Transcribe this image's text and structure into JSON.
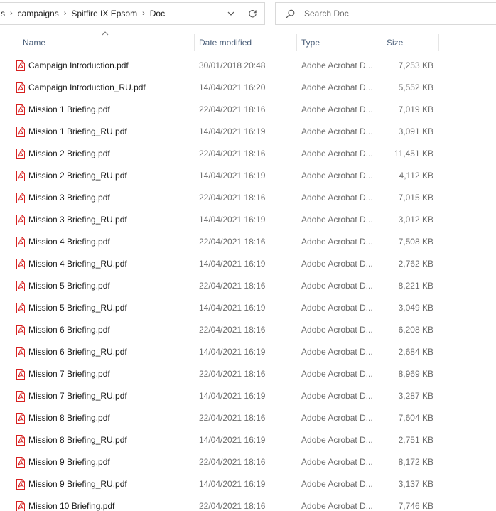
{
  "address_bar": {
    "crumbs": [
      "s",
      "campaigns",
      "Spitfire IX Epsom",
      "Doc"
    ]
  },
  "search": {
    "placeholder": "Search Doc"
  },
  "columns": {
    "name": "Name",
    "date": "Date modified",
    "type": "Type",
    "size": "Size"
  },
  "colors": {
    "pdf_icon": "#d6201f",
    "header_text": "#4c607a",
    "secondary_text": "#6d6d6d"
  },
  "files": [
    {
      "name": "Campaign Introduction.pdf",
      "date": "30/01/2018 20:48",
      "type": "Adobe Acrobat D...",
      "size": "7,253 KB"
    },
    {
      "name": "Campaign Introduction_RU.pdf",
      "date": "14/04/2021 16:20",
      "type": "Adobe Acrobat D...",
      "size": "5,552 KB"
    },
    {
      "name": "Mission 1 Briefing.pdf",
      "date": "22/04/2021 18:16",
      "type": "Adobe Acrobat D...",
      "size": "7,019 KB"
    },
    {
      "name": "Mission 1 Briefing_RU.pdf",
      "date": "14/04/2021 16:19",
      "type": "Adobe Acrobat D...",
      "size": "3,091 KB"
    },
    {
      "name": "Mission 2 Briefing.pdf",
      "date": "22/04/2021 18:16",
      "type": "Adobe Acrobat D...",
      "size": "11,451 KB"
    },
    {
      "name": "Mission 2 Briefing_RU.pdf",
      "date": "14/04/2021 16:19",
      "type": "Adobe Acrobat D...",
      "size": "4,112 KB"
    },
    {
      "name": "Mission 3 Briefing.pdf",
      "date": "22/04/2021 18:16",
      "type": "Adobe Acrobat D...",
      "size": "7,015 KB"
    },
    {
      "name": "Mission 3 Briefing_RU.pdf",
      "date": "14/04/2021 16:19",
      "type": "Adobe Acrobat D...",
      "size": "3,012 KB"
    },
    {
      "name": "Mission 4 Briefing.pdf",
      "date": "22/04/2021 18:16",
      "type": "Adobe Acrobat D...",
      "size": "7,508 KB"
    },
    {
      "name": "Mission 4 Briefing_RU.pdf",
      "date": "14/04/2021 16:19",
      "type": "Adobe Acrobat D...",
      "size": "2,762 KB"
    },
    {
      "name": "Mission 5 Briefing.pdf",
      "date": "22/04/2021 18:16",
      "type": "Adobe Acrobat D...",
      "size": "8,221 KB"
    },
    {
      "name": "Mission 5 Briefing_RU.pdf",
      "date": "14/04/2021 16:19",
      "type": "Adobe Acrobat D...",
      "size": "3,049 KB"
    },
    {
      "name": "Mission 6 Briefing.pdf",
      "date": "22/04/2021 18:16",
      "type": "Adobe Acrobat D...",
      "size": "6,208 KB"
    },
    {
      "name": "Mission 6 Briefing_RU.pdf",
      "date": "14/04/2021 16:19",
      "type": "Adobe Acrobat D...",
      "size": "2,684 KB"
    },
    {
      "name": "Mission 7 Briefing.pdf",
      "date": "22/04/2021 18:16",
      "type": "Adobe Acrobat D...",
      "size": "8,969 KB"
    },
    {
      "name": "Mission 7 Briefing_RU.pdf",
      "date": "14/04/2021 16:19",
      "type": "Adobe Acrobat D...",
      "size": "3,287 KB"
    },
    {
      "name": "Mission 8 Briefing.pdf",
      "date": "22/04/2021 18:16",
      "type": "Adobe Acrobat D...",
      "size": "7,604 KB"
    },
    {
      "name": "Mission 8 Briefing_RU.pdf",
      "date": "14/04/2021 16:19",
      "type": "Adobe Acrobat D...",
      "size": "2,751 KB"
    },
    {
      "name": "Mission 9 Briefing.pdf",
      "date": "22/04/2021 18:16",
      "type": "Adobe Acrobat D...",
      "size": "8,172 KB"
    },
    {
      "name": "Mission 9 Briefing_RU.pdf",
      "date": "14/04/2021 16:19",
      "type": "Adobe Acrobat D...",
      "size": "3,137 KB"
    },
    {
      "name": "Mission 10 Briefing.pdf",
      "date": "22/04/2021 18:16",
      "type": "Adobe Acrobat D...",
      "size": "7,746 KB"
    }
  ]
}
